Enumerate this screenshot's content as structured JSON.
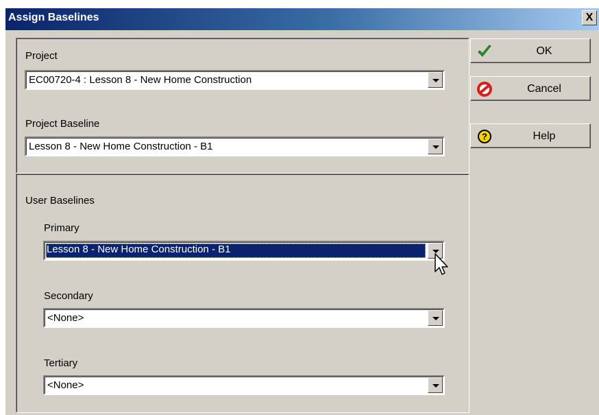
{
  "window": {
    "title": "Assign Baselines",
    "close_glyph": "X"
  },
  "project": {
    "label": "Project",
    "value": "EC00720-4 : Lesson 8 - New Home Construction"
  },
  "project_baseline": {
    "label": "Project Baseline",
    "value": "Lesson 8 - New Home Construction - B1"
  },
  "user_baselines": {
    "label": "User Baselines",
    "primary": {
      "label": "Primary",
      "value": "Lesson 8 - New Home Construction - B1",
      "selected": true
    },
    "secondary": {
      "label": "Secondary",
      "value": "<None>"
    },
    "tertiary": {
      "label": "Tertiary",
      "value": "<None>"
    }
  },
  "buttons": {
    "ok": {
      "label": "OK",
      "icon": "checkmark-icon",
      "color": "#2e9b2e"
    },
    "cancel": {
      "label": "Cancel",
      "icon": "cancel-icon",
      "color": "#d81e1e"
    },
    "help": {
      "label": "Help",
      "icon": "help-icon",
      "color": "#f5d400"
    }
  },
  "colors": {
    "titlebar": "#0a246a",
    "dialog_bg": "#d4d0c8",
    "selection": "#0a246a"
  }
}
